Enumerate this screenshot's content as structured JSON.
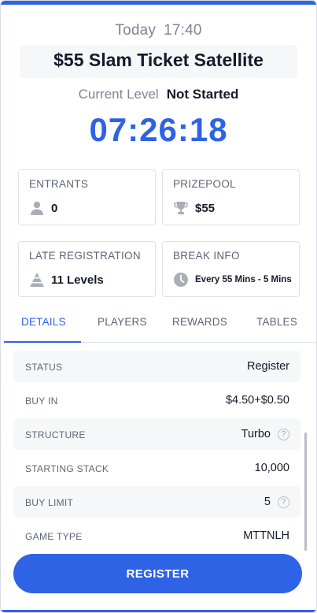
{
  "header": {
    "day": "Today",
    "time": "17:40"
  },
  "tournament": {
    "title": "$55 Slam Ticket Satellite"
  },
  "level": {
    "label": "Current Level",
    "value": "Not Started"
  },
  "timer": "07:26:18",
  "cards": {
    "entrants": {
      "label": "ENTRANTS",
      "value": "0",
      "icon": "person-icon"
    },
    "prizepool": {
      "label": "PRIZEPOOL",
      "value": "$55",
      "icon": "trophy-icon"
    },
    "late_registration": {
      "label": "LATE REGISTRATION",
      "value": "11 Levels",
      "icon": "levels-icon"
    },
    "break_info": {
      "label": "BREAK INFO",
      "value": "Every 55 Mins - 5 Mins",
      "icon": "clock-icon"
    }
  },
  "tabs": [
    "DETAILS",
    "PLAYERS",
    "REWARDS",
    "TABLES"
  ],
  "active_tab": "DETAILS",
  "details": [
    {
      "label": "STATUS",
      "value": "Register",
      "help": false
    },
    {
      "label": "BUY IN",
      "value": "$4.50+$0.50",
      "help": false
    },
    {
      "label": "STRUCTURE",
      "value": "Turbo",
      "help": true
    },
    {
      "label": "STARTING STACK",
      "value": "10,000",
      "help": false
    },
    {
      "label": "BUY LIMIT",
      "value": "5",
      "help": true
    },
    {
      "label": "GAME TYPE",
      "value": "MTTNLH",
      "help": false
    }
  ],
  "help_glyph": "?",
  "register_label": "REGISTER",
  "colors": {
    "accent": "#2f63e6",
    "text": "#131a29",
    "muted": "#7c8592",
    "row_shade": "#f6f7f9"
  }
}
